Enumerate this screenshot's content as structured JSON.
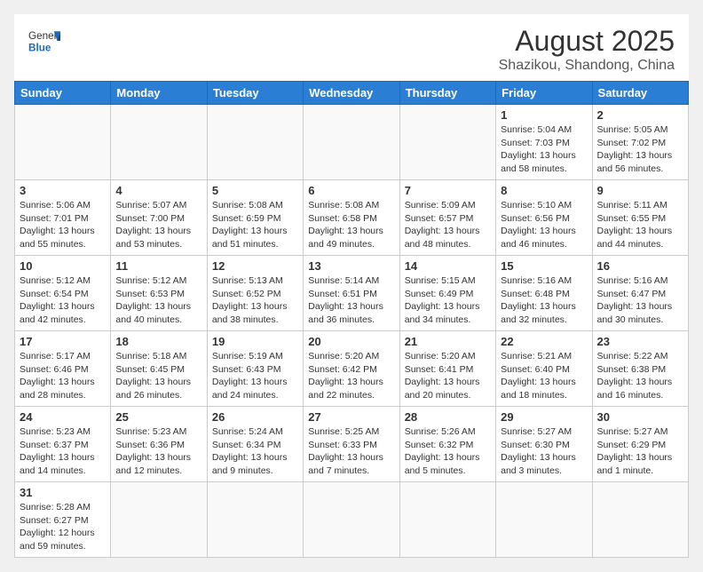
{
  "header": {
    "logo_general": "General",
    "logo_blue": "Blue",
    "month_year": "August 2025",
    "location": "Shazikou, Shandong, China"
  },
  "weekdays": [
    "Sunday",
    "Monday",
    "Tuesday",
    "Wednesday",
    "Thursday",
    "Friday",
    "Saturday"
  ],
  "weeks": [
    [
      {
        "day": "",
        "info": ""
      },
      {
        "day": "",
        "info": ""
      },
      {
        "day": "",
        "info": ""
      },
      {
        "day": "",
        "info": ""
      },
      {
        "day": "",
        "info": ""
      },
      {
        "day": "1",
        "info": "Sunrise: 5:04 AM\nSunset: 7:03 PM\nDaylight: 13 hours\nand 58 minutes."
      },
      {
        "day": "2",
        "info": "Sunrise: 5:05 AM\nSunset: 7:02 PM\nDaylight: 13 hours\nand 56 minutes."
      }
    ],
    [
      {
        "day": "3",
        "info": "Sunrise: 5:06 AM\nSunset: 7:01 PM\nDaylight: 13 hours\nand 55 minutes."
      },
      {
        "day": "4",
        "info": "Sunrise: 5:07 AM\nSunset: 7:00 PM\nDaylight: 13 hours\nand 53 minutes."
      },
      {
        "day": "5",
        "info": "Sunrise: 5:08 AM\nSunset: 6:59 PM\nDaylight: 13 hours\nand 51 minutes."
      },
      {
        "day": "6",
        "info": "Sunrise: 5:08 AM\nSunset: 6:58 PM\nDaylight: 13 hours\nand 49 minutes."
      },
      {
        "day": "7",
        "info": "Sunrise: 5:09 AM\nSunset: 6:57 PM\nDaylight: 13 hours\nand 48 minutes."
      },
      {
        "day": "8",
        "info": "Sunrise: 5:10 AM\nSunset: 6:56 PM\nDaylight: 13 hours\nand 46 minutes."
      },
      {
        "day": "9",
        "info": "Sunrise: 5:11 AM\nSunset: 6:55 PM\nDaylight: 13 hours\nand 44 minutes."
      }
    ],
    [
      {
        "day": "10",
        "info": "Sunrise: 5:12 AM\nSunset: 6:54 PM\nDaylight: 13 hours\nand 42 minutes."
      },
      {
        "day": "11",
        "info": "Sunrise: 5:12 AM\nSunset: 6:53 PM\nDaylight: 13 hours\nand 40 minutes."
      },
      {
        "day": "12",
        "info": "Sunrise: 5:13 AM\nSunset: 6:52 PM\nDaylight: 13 hours\nand 38 minutes."
      },
      {
        "day": "13",
        "info": "Sunrise: 5:14 AM\nSunset: 6:51 PM\nDaylight: 13 hours\nand 36 minutes."
      },
      {
        "day": "14",
        "info": "Sunrise: 5:15 AM\nSunset: 6:49 PM\nDaylight: 13 hours\nand 34 minutes."
      },
      {
        "day": "15",
        "info": "Sunrise: 5:16 AM\nSunset: 6:48 PM\nDaylight: 13 hours\nand 32 minutes."
      },
      {
        "day": "16",
        "info": "Sunrise: 5:16 AM\nSunset: 6:47 PM\nDaylight: 13 hours\nand 30 minutes."
      }
    ],
    [
      {
        "day": "17",
        "info": "Sunrise: 5:17 AM\nSunset: 6:46 PM\nDaylight: 13 hours\nand 28 minutes."
      },
      {
        "day": "18",
        "info": "Sunrise: 5:18 AM\nSunset: 6:45 PM\nDaylight: 13 hours\nand 26 minutes."
      },
      {
        "day": "19",
        "info": "Sunrise: 5:19 AM\nSunset: 6:43 PM\nDaylight: 13 hours\nand 24 minutes."
      },
      {
        "day": "20",
        "info": "Sunrise: 5:20 AM\nSunset: 6:42 PM\nDaylight: 13 hours\nand 22 minutes."
      },
      {
        "day": "21",
        "info": "Sunrise: 5:20 AM\nSunset: 6:41 PM\nDaylight: 13 hours\nand 20 minutes."
      },
      {
        "day": "22",
        "info": "Sunrise: 5:21 AM\nSunset: 6:40 PM\nDaylight: 13 hours\nand 18 minutes."
      },
      {
        "day": "23",
        "info": "Sunrise: 5:22 AM\nSunset: 6:38 PM\nDaylight: 13 hours\nand 16 minutes."
      }
    ],
    [
      {
        "day": "24",
        "info": "Sunrise: 5:23 AM\nSunset: 6:37 PM\nDaylight: 13 hours\nand 14 minutes."
      },
      {
        "day": "25",
        "info": "Sunrise: 5:23 AM\nSunset: 6:36 PM\nDaylight: 13 hours\nand 12 minutes."
      },
      {
        "day": "26",
        "info": "Sunrise: 5:24 AM\nSunset: 6:34 PM\nDaylight: 13 hours\nand 9 minutes."
      },
      {
        "day": "27",
        "info": "Sunrise: 5:25 AM\nSunset: 6:33 PM\nDaylight: 13 hours\nand 7 minutes."
      },
      {
        "day": "28",
        "info": "Sunrise: 5:26 AM\nSunset: 6:32 PM\nDaylight: 13 hours\nand 5 minutes."
      },
      {
        "day": "29",
        "info": "Sunrise: 5:27 AM\nSunset: 6:30 PM\nDaylight: 13 hours\nand 3 minutes."
      },
      {
        "day": "30",
        "info": "Sunrise: 5:27 AM\nSunset: 6:29 PM\nDaylight: 13 hours\nand 1 minute."
      }
    ],
    [
      {
        "day": "31",
        "info": "Sunrise: 5:28 AM\nSunset: 6:27 PM\nDaylight: 12 hours\nand 59 minutes."
      },
      {
        "day": "",
        "info": ""
      },
      {
        "day": "",
        "info": ""
      },
      {
        "day": "",
        "info": ""
      },
      {
        "day": "",
        "info": ""
      },
      {
        "day": "",
        "info": ""
      },
      {
        "day": "",
        "info": ""
      }
    ]
  ]
}
